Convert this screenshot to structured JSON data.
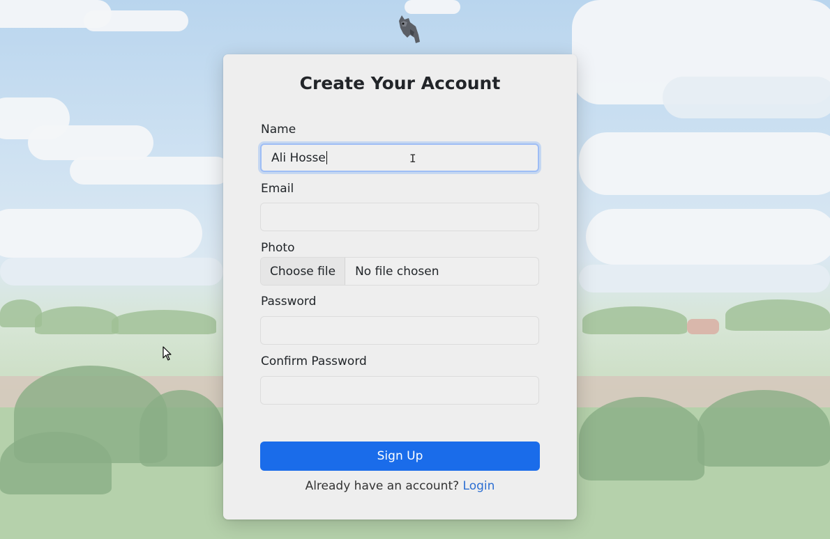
{
  "form": {
    "title": "Create Your Account",
    "name_label": "Name",
    "name_value": "Ali Hosse",
    "email_label": "Email",
    "email_value": "",
    "photo_label": "Photo",
    "photo_button": "Choose file",
    "photo_status": "No file chosen",
    "password_label": "Password",
    "password_value": "",
    "confirm_label": "Confirm Password",
    "confirm_value": "",
    "submit_label": "Sign Up",
    "footer_text": "Already have an account?",
    "login_link": "Login"
  },
  "colors": {
    "accent": "#1a6cea",
    "link": "#2b6ed2",
    "card": "#eeeeee",
    "focus_ring": "#9ebdf5"
  },
  "icons": {
    "mascot": "cat-mascot-icon",
    "mouse": "mouse-pointer-icon",
    "text_cursor": "text-cursor-icon"
  }
}
